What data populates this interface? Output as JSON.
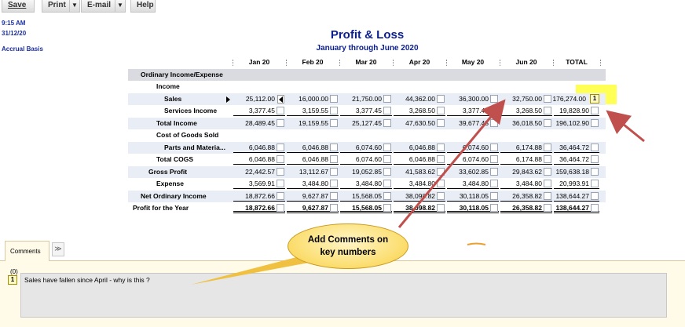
{
  "toolbar": {
    "save_label": "Save",
    "print_label": "Print",
    "email_label": "E-mail",
    "help_label": "Help",
    "dropdown_glyph": "▼"
  },
  "report_meta": {
    "time": "9:15 AM",
    "date": "31/12/20",
    "basis": "Accrual Basis"
  },
  "report": {
    "title": "Profit & Loss",
    "subtitle": "January through June 2020",
    "columns": [
      "Jan 20",
      "Feb 20",
      "Mar 20",
      "Apr 20",
      "May 20",
      "Jun 20",
      "TOTAL"
    ],
    "rows": [
      {
        "label": "Ordinary Income/Expense",
        "values": []
      },
      {
        "label": "Income",
        "values": []
      },
      {
        "label": "Sales",
        "values": [
          "25,112.00",
          "16,000.00",
          "21,750.00",
          "44,362.00",
          "36,300.00",
          "32,750.00",
          "176,274.00"
        ]
      },
      {
        "label": "Services Income",
        "values": [
          "3,377.45",
          "3,159.55",
          "3,377.45",
          "3,268.50",
          "3,377.45",
          "3,268.50",
          "19,828.90"
        ]
      },
      {
        "label": "Total Income",
        "values": [
          "28,489.45",
          "19,159.55",
          "25,127.45",
          "47,630.50",
          "39,677.45",
          "36,018.50",
          "196,102.90"
        ]
      },
      {
        "label": "Cost of Goods Sold",
        "values": []
      },
      {
        "label": "Parts and Materia...",
        "values": [
          "6,046.88",
          "6,046.88",
          "6,074.60",
          "6,046.88",
          "6,074.60",
          "6,174.88",
          "36,464.72"
        ]
      },
      {
        "label": "Total COGS",
        "values": [
          "6,046.88",
          "6,046.88",
          "6,074.60",
          "6,046.88",
          "6,074.60",
          "6,174.88",
          "36,464.72"
        ]
      },
      {
        "label": "Gross Profit",
        "values": [
          "22,442.57",
          "13,112.67",
          "19,052.85",
          "41,583.62",
          "33,602.85",
          "29,843.62",
          "159,638.18"
        ]
      },
      {
        "label": "Expense",
        "values": [
          "3,569.91",
          "3,484.80",
          "3,484.80",
          "3,484.80",
          "3,484.80",
          "3,484.80",
          "20,993.91"
        ]
      },
      {
        "label": "Net Ordinary Income",
        "values": [
          "18,872.66",
          "9,627.87",
          "15,568.05",
          "38,098.82",
          "30,118.05",
          "26,358.82",
          "138,644.27"
        ]
      },
      {
        "label": "Profit for the Year",
        "values": [
          "18,872.66",
          "9,627.87",
          "15,568.05",
          "38,098.82",
          "30,118.05",
          "26,358.82",
          "138,644.27"
        ]
      }
    ],
    "comment_marker": "1"
  },
  "comments": {
    "tab_label": "Comments",
    "count": "(0)",
    "collapse_glyph": "≫",
    "marker": "1",
    "text": "Sales have fallen since April - why is this ?"
  },
  "callout": {
    "line1": "Add Comments on",
    "line2": "key numbers"
  },
  "colors": {
    "title": "#0b1f8f",
    "arrow": "#c0504d",
    "callout_fill": "#fbdc6a",
    "highlight": "#ffff55",
    "comment_bg": "#fffbe8"
  }
}
